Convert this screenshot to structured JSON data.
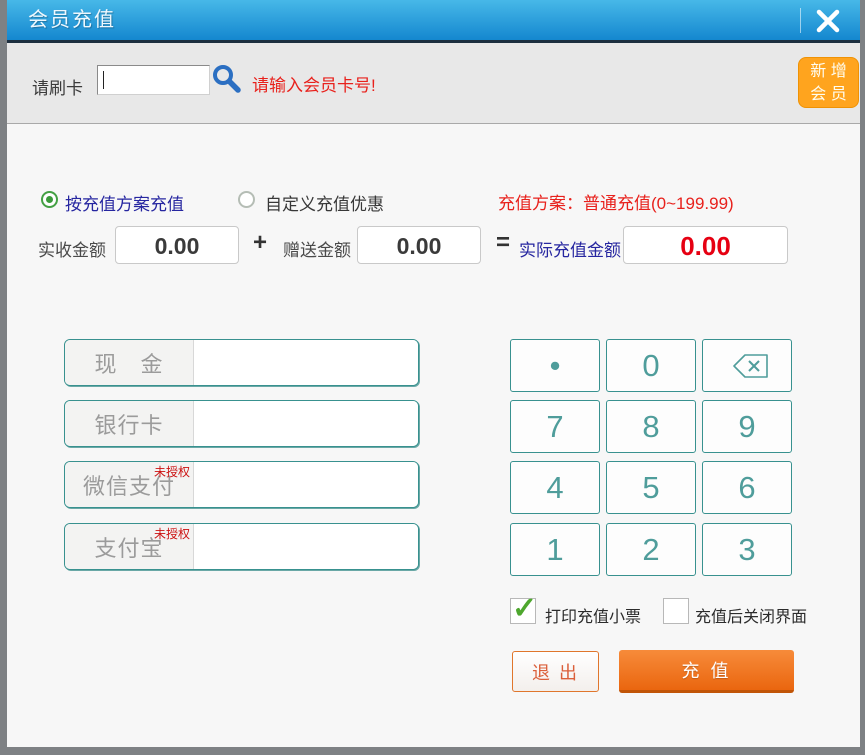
{
  "window": {
    "title": "会员充值"
  },
  "card": {
    "label": "请刷卡",
    "value": "",
    "hint": "请输入会员卡号!",
    "new_member_line1": "新 增",
    "new_member_line2": "会 员"
  },
  "plan": {
    "option_plan": "按充值方案充值",
    "option_custom": "自定义充值优惠",
    "scheme_info": "充值方案：普通充值(0~199.99)"
  },
  "amounts": {
    "received_label": "实收金额",
    "received_value": "0.00",
    "plus": "+",
    "gift_label": "赠送金额",
    "gift_value": "0.00",
    "equals": "=",
    "actual_label": "实际充值金额",
    "actual_value": "0.00"
  },
  "payments": [
    {
      "label": "现　金",
      "badge": "",
      "value": ""
    },
    {
      "label": "银行卡",
      "badge": "",
      "value": ""
    },
    {
      "label": "微信支付",
      "badge": "未授权",
      "value": ""
    },
    {
      "label": "支付宝",
      "badge": "未授权",
      "value": ""
    }
  ],
  "numpad": {
    "keys": [
      "•",
      "0",
      "⌫",
      "7",
      "8",
      "9",
      "4",
      "5",
      "6",
      "1",
      "2",
      "3"
    ]
  },
  "options": [
    {
      "label": "打印充值小票",
      "checked": true
    },
    {
      "label": "充值后关闭界面",
      "checked": false
    }
  ],
  "actions": {
    "exit": "退 出",
    "recharge": "充 值"
  },
  "colors": {
    "titlebar_blue": "#2aa3dc",
    "accent_orange": "#ffa41e",
    "button_orange": "#ee6a10",
    "teal_border": "#38918f",
    "alert_red": "#e8211c",
    "navy_label": "#2626a0",
    "radio_green": "#44a044",
    "check_green": "#4ea72e"
  }
}
